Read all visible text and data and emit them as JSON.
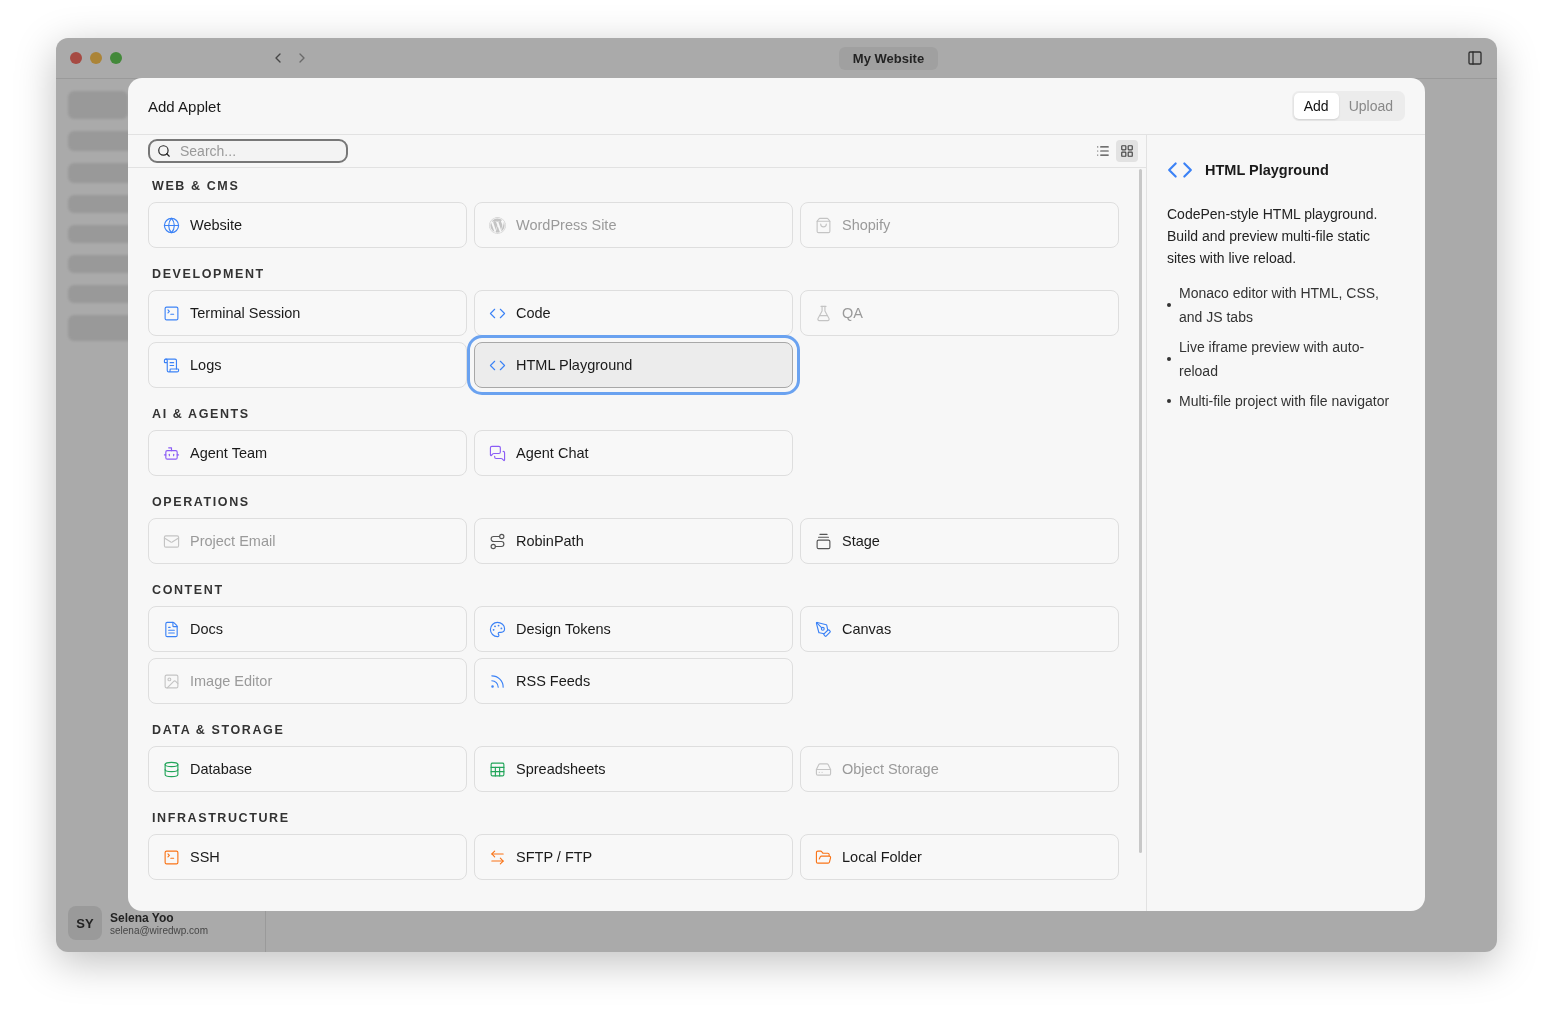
{
  "window": {
    "title": "My Website",
    "user": {
      "initials": "SY",
      "name": "Selena Yoo",
      "email": "selena@wiredwp.com"
    }
  },
  "dialog": {
    "title": "Add Applet",
    "modes": [
      {
        "label": "Add",
        "selected": true
      },
      {
        "label": "Upload",
        "selected": false
      }
    ],
    "search": {
      "placeholder": "Search..."
    },
    "view_modes": [
      {
        "kind": "list",
        "selected": false
      },
      {
        "kind": "grid",
        "selected": true
      }
    ],
    "sections": [
      {
        "title": "WEB & CMS",
        "items": [
          {
            "label": "Website",
            "disabled": false,
            "selected": false
          },
          {
            "label": "WordPress Site",
            "disabled": true,
            "selected": false
          },
          {
            "label": "Shopify",
            "disabled": true,
            "selected": false
          }
        ]
      },
      {
        "title": "DEVELOPMENT",
        "items": [
          {
            "label": "Terminal Session",
            "disabled": false,
            "selected": false
          },
          {
            "label": "Code",
            "disabled": false,
            "selected": false
          },
          {
            "label": "QA",
            "disabled": true,
            "selected": false
          },
          {
            "label": "Logs",
            "disabled": false,
            "selected": false
          },
          {
            "label": "HTML Playground",
            "disabled": false,
            "selected": true
          }
        ]
      },
      {
        "title": "AI & AGENTS",
        "items": [
          {
            "label": "Agent Team",
            "disabled": false,
            "selected": false
          },
          {
            "label": "Agent Chat",
            "disabled": false,
            "selected": false
          }
        ]
      },
      {
        "title": "OPERATIONS",
        "items": [
          {
            "label": "Project Email",
            "disabled": true,
            "selected": false
          },
          {
            "label": "RobinPath",
            "disabled": false,
            "selected": false
          },
          {
            "label": "Stage",
            "disabled": false,
            "selected": false
          }
        ]
      },
      {
        "title": "CONTENT",
        "items": [
          {
            "label": "Docs",
            "disabled": false,
            "selected": false
          },
          {
            "label": "Design Tokens",
            "disabled": false,
            "selected": false
          },
          {
            "label": "Canvas",
            "disabled": false,
            "selected": false
          },
          {
            "label": "Image Editor",
            "disabled": true,
            "selected": false
          },
          {
            "label": "RSS Feeds",
            "disabled": false,
            "selected": false
          }
        ]
      },
      {
        "title": "DATA & STORAGE",
        "items": [
          {
            "label": "Database",
            "disabled": false,
            "selected": false
          },
          {
            "label": "Spreadsheets",
            "disabled": false,
            "selected": false
          },
          {
            "label": "Object Storage",
            "disabled": true,
            "selected": false
          }
        ]
      },
      {
        "title": "INFRASTRUCTURE",
        "items": [
          {
            "label": "SSH",
            "disabled": false,
            "selected": false
          },
          {
            "label": "SFTP / FTP",
            "disabled": false,
            "selected": false
          },
          {
            "label": "Local Folder",
            "disabled": false,
            "selected": false
          }
        ]
      }
    ],
    "detail": {
      "title": "HTML Playground",
      "description": "CodePen-style HTML playground. Build and preview multi-file static sites with live reload.",
      "features": [
        "Monaco editor with HTML, CSS, and JS tabs",
        "Live iframe preview with auto-reload",
        "Multi-file project with file navigator"
      ]
    }
  }
}
